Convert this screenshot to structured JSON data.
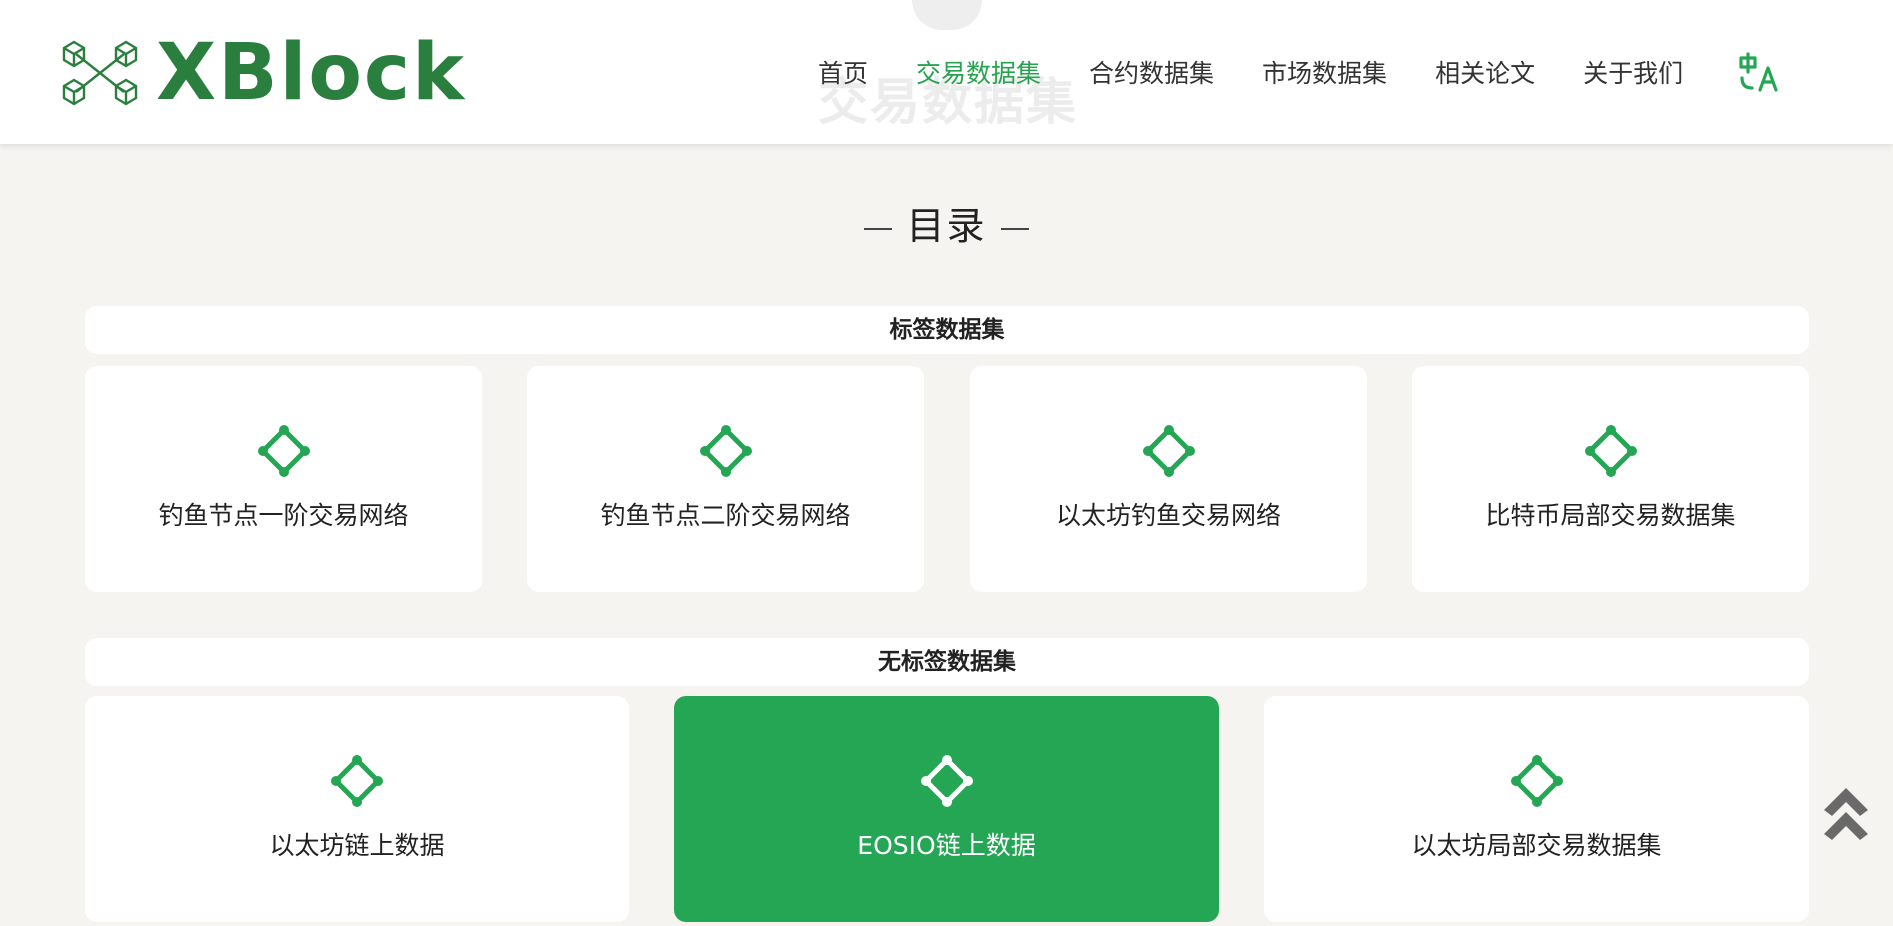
{
  "header": {
    "logo_text": "XBlock",
    "ghost_text": "交易数据集",
    "nav": [
      {
        "label": "首页",
        "active": false
      },
      {
        "label": "交易数据集",
        "active": true
      },
      {
        "label": "合约数据集",
        "active": false
      },
      {
        "label": "市场数据集",
        "active": false
      },
      {
        "label": "相关论文",
        "active": false
      },
      {
        "label": "关于我们",
        "active": false
      }
    ],
    "lang_icon": "translate-icon"
  },
  "catalog": {
    "title": "目录",
    "labeled": {
      "title": "标签数据集",
      "items": [
        {
          "label": "钓鱼节点一阶交易网络",
          "icon": "network-node-icon"
        },
        {
          "label": "钓鱼节点二阶交易网络",
          "icon": "network-node-icon"
        },
        {
          "label": "以太坊钓鱼交易网络",
          "icon": "network-node-icon"
        },
        {
          "label": "比特币局部交易数据集",
          "icon": "network-node-icon"
        }
      ]
    },
    "unlabeled": {
      "title": "无标签数据集",
      "items": [
        {
          "label": "以太坊链上数据",
          "icon": "network-node-icon"
        },
        {
          "label": "EOSIO链上数据",
          "icon": "network-node-icon",
          "highlighted": true
        },
        {
          "label": "以太坊局部交易数据集",
          "icon": "network-node-icon"
        }
      ]
    }
  },
  "colors": {
    "brand_green": "#2a7f3e",
    "accent_green": "#25a654",
    "background": "#f5f4f1"
  },
  "scroll_top_icon": "double-chevron-up-icon"
}
